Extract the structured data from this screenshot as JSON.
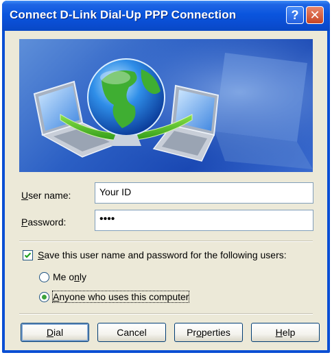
{
  "window": {
    "title": "Connect D-Link Dial-Up PPP Connection",
    "help_label": "?",
    "close_label": "✕"
  },
  "form": {
    "username_label_accel": "U",
    "username_label_rest": "ser name:",
    "username_value": "Your ID",
    "password_label_accel": "P",
    "password_label_rest": "assword:",
    "password_value": "••••"
  },
  "save": {
    "checked": true,
    "label_accel": "S",
    "label_rest": "ave this user name and password for the following users:",
    "me_only_pre": "Me o",
    "me_only_accel": "n",
    "me_only_post": "ly",
    "anyone_accel": "A",
    "anyone_rest": "nyone who uses this computer",
    "selected": "anyone"
  },
  "buttons": {
    "dial_accel": "D",
    "dial_rest": "ial",
    "cancel": "Cancel",
    "properties_pre": "Pr",
    "properties_accel": "o",
    "properties_post": "perties",
    "help_accel": "H",
    "help_rest": "elp"
  },
  "colors": {
    "titlebar": "#0a55de",
    "dialog_bg": "#ece9d8",
    "banner": "#2b5fc4"
  },
  "icons": [
    "network-banner-graphic",
    "help-icon",
    "close-icon",
    "checkmark-icon"
  ]
}
